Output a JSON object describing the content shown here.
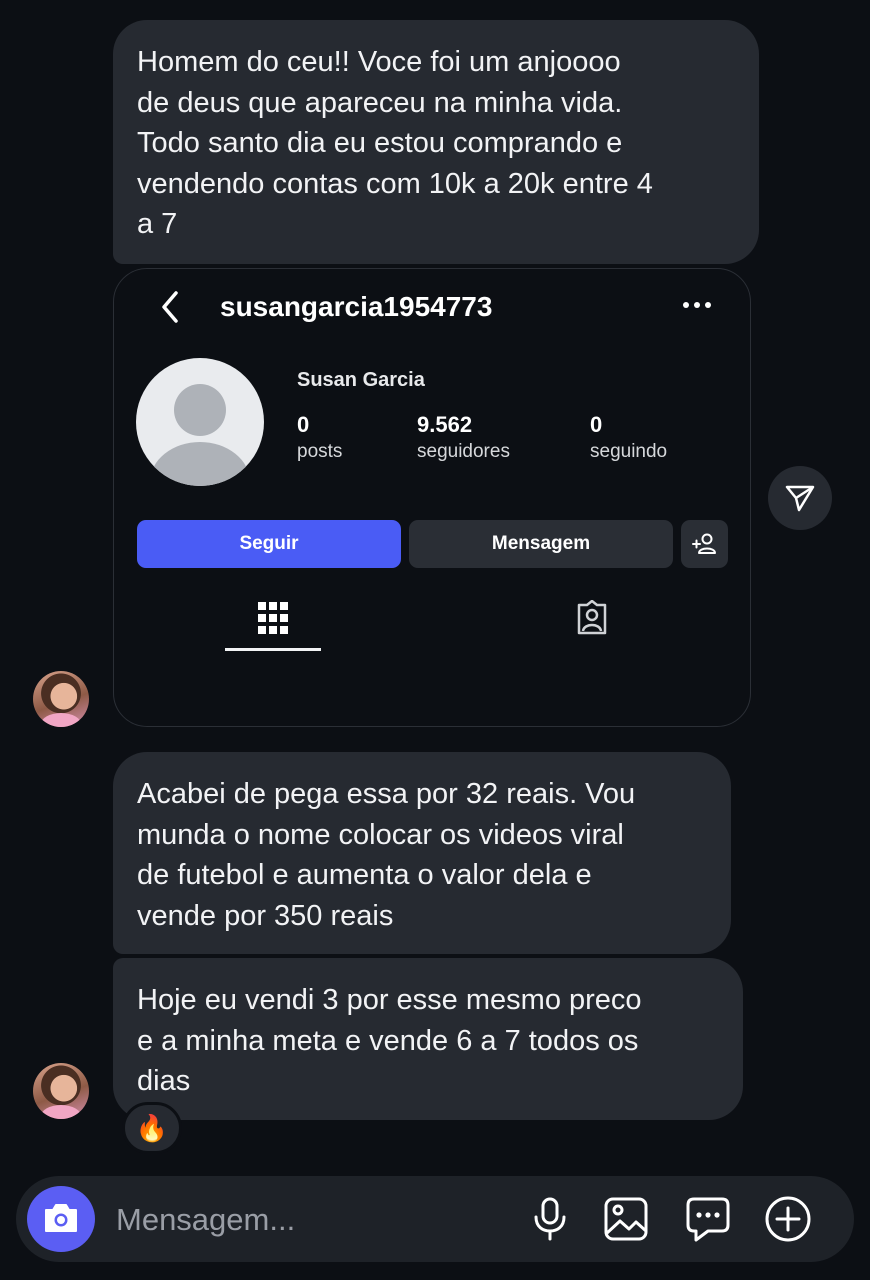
{
  "messages": [
    {
      "text": "Homem do ceu!! Voce  foi um anjoooo\nde deus que apareceu na minha vida.\nTodo santo dia eu estou comprando e\nvendendo contas com 10k a 20k entre 4\na 7"
    },
    {
      "text": "Acabei de pega essa por 32 reais. Vou\nmunda o nome colocar os videos viral\nde futebol e aumenta o valor dela e\nvende por 350 reais"
    },
    {
      "text": "Hoje eu vendi 3 por esse mesmo preco\ne a minha meta e vende 6 a 7 todos os\ndias"
    }
  ],
  "shared_profile": {
    "username": "susangarcia1954773",
    "full_name": "Susan Garcia",
    "stats": {
      "posts_count": "0",
      "posts_label": "posts",
      "followers_count": "9.562",
      "followers_label": "seguidores",
      "following_count": "0",
      "following_label": "seguindo"
    },
    "buttons": {
      "follow": "Seguir",
      "message": "Mensagem"
    }
  },
  "reaction": "🔥",
  "composer": {
    "placeholder": "Mensagem..."
  },
  "colors": {
    "background": "#0c0f14",
    "bubble": "#262a31",
    "follow": "#4a5cf5",
    "camera": "#5b5ef3"
  }
}
